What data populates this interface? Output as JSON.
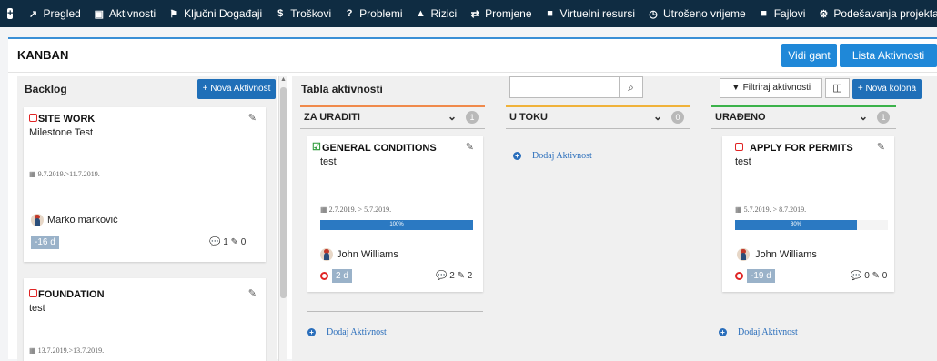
{
  "nav": {
    "items": [
      {
        "icon": "chart-line-icon",
        "glyph": "↗",
        "label": "Pregled"
      },
      {
        "icon": "tasks-icon",
        "glyph": "▣",
        "label": "Aktivnosti"
      },
      {
        "icon": "flag-icon",
        "glyph": "⚑",
        "label": "Ključni Događaji"
      },
      {
        "icon": "dollar-icon",
        "glyph": "$",
        "label": "Troškovi"
      },
      {
        "icon": "question-icon",
        "glyph": "?",
        "label": "Problemi"
      },
      {
        "icon": "warning-icon",
        "glyph": "▲",
        "label": "Rizici"
      },
      {
        "icon": "exchange-icon",
        "glyph": "⇄",
        "label": "Promjene"
      },
      {
        "icon": "briefcase-icon",
        "glyph": "■",
        "label": "Virtuelni resursi"
      },
      {
        "icon": "clock-icon",
        "glyph": "◷",
        "label": "Utrošeno vrijeme"
      },
      {
        "icon": "folder-icon",
        "glyph": "■",
        "label": "Fajlovi"
      },
      {
        "icon": "cogs-icon",
        "glyph": "⚙",
        "label": "Podešavanja projekta"
      }
    ]
  },
  "header": {
    "title": "KANBAN",
    "gantt_button": "Vidi gant",
    "list_button": "Lista Aktivnosti"
  },
  "backlog": {
    "title": "Backlog",
    "new_button": "+ Nova Aktivnost",
    "cards": [
      {
        "title": "SITE WORK",
        "subtitle": "Milestone Test",
        "dates": "9.7.2019.>11.7.2019.",
        "person": "Marko marković",
        "days": "-16 d",
        "counts": "1 ✎ 0"
      },
      {
        "title": "FOUNDATION",
        "subtitle": "test",
        "dates": "13.7.2019.>13.7.2019."
      }
    ]
  },
  "board": {
    "title": "Tabla aktivnosti",
    "search_placeholder": "",
    "filter_button": "Filtriraj aktivnosti",
    "new_column_button": "+ Nova kolona",
    "add_label": "Dodaj Aktivnost",
    "columns": [
      {
        "name": "ZA URADITI",
        "count": "1",
        "color": "#f08a4b",
        "card": {
          "title": "GENERAL CONDITIONS",
          "subtitle": "test",
          "dates": "2.7.2019. > 5.7.2019.",
          "progress_label": "100%",
          "progress": 1.0,
          "person": "John Williams",
          "days": "2 d",
          "counts": "2 ✎ 2"
        }
      },
      {
        "name": "U TOKU",
        "count": "0",
        "color": "#f0b23a"
      },
      {
        "name": "URAĐENO",
        "count": "1",
        "color": "#3bb24a",
        "card": {
          "title": "APPLY FOR PERMITS",
          "subtitle": "test",
          "dates": "5.7.2019. > 8.7.2019.",
          "progress_label": "80%",
          "progress": 0.8,
          "person": "John Williams",
          "days": "-19 d",
          "counts": "0 ✎ 0"
        }
      }
    ]
  }
}
